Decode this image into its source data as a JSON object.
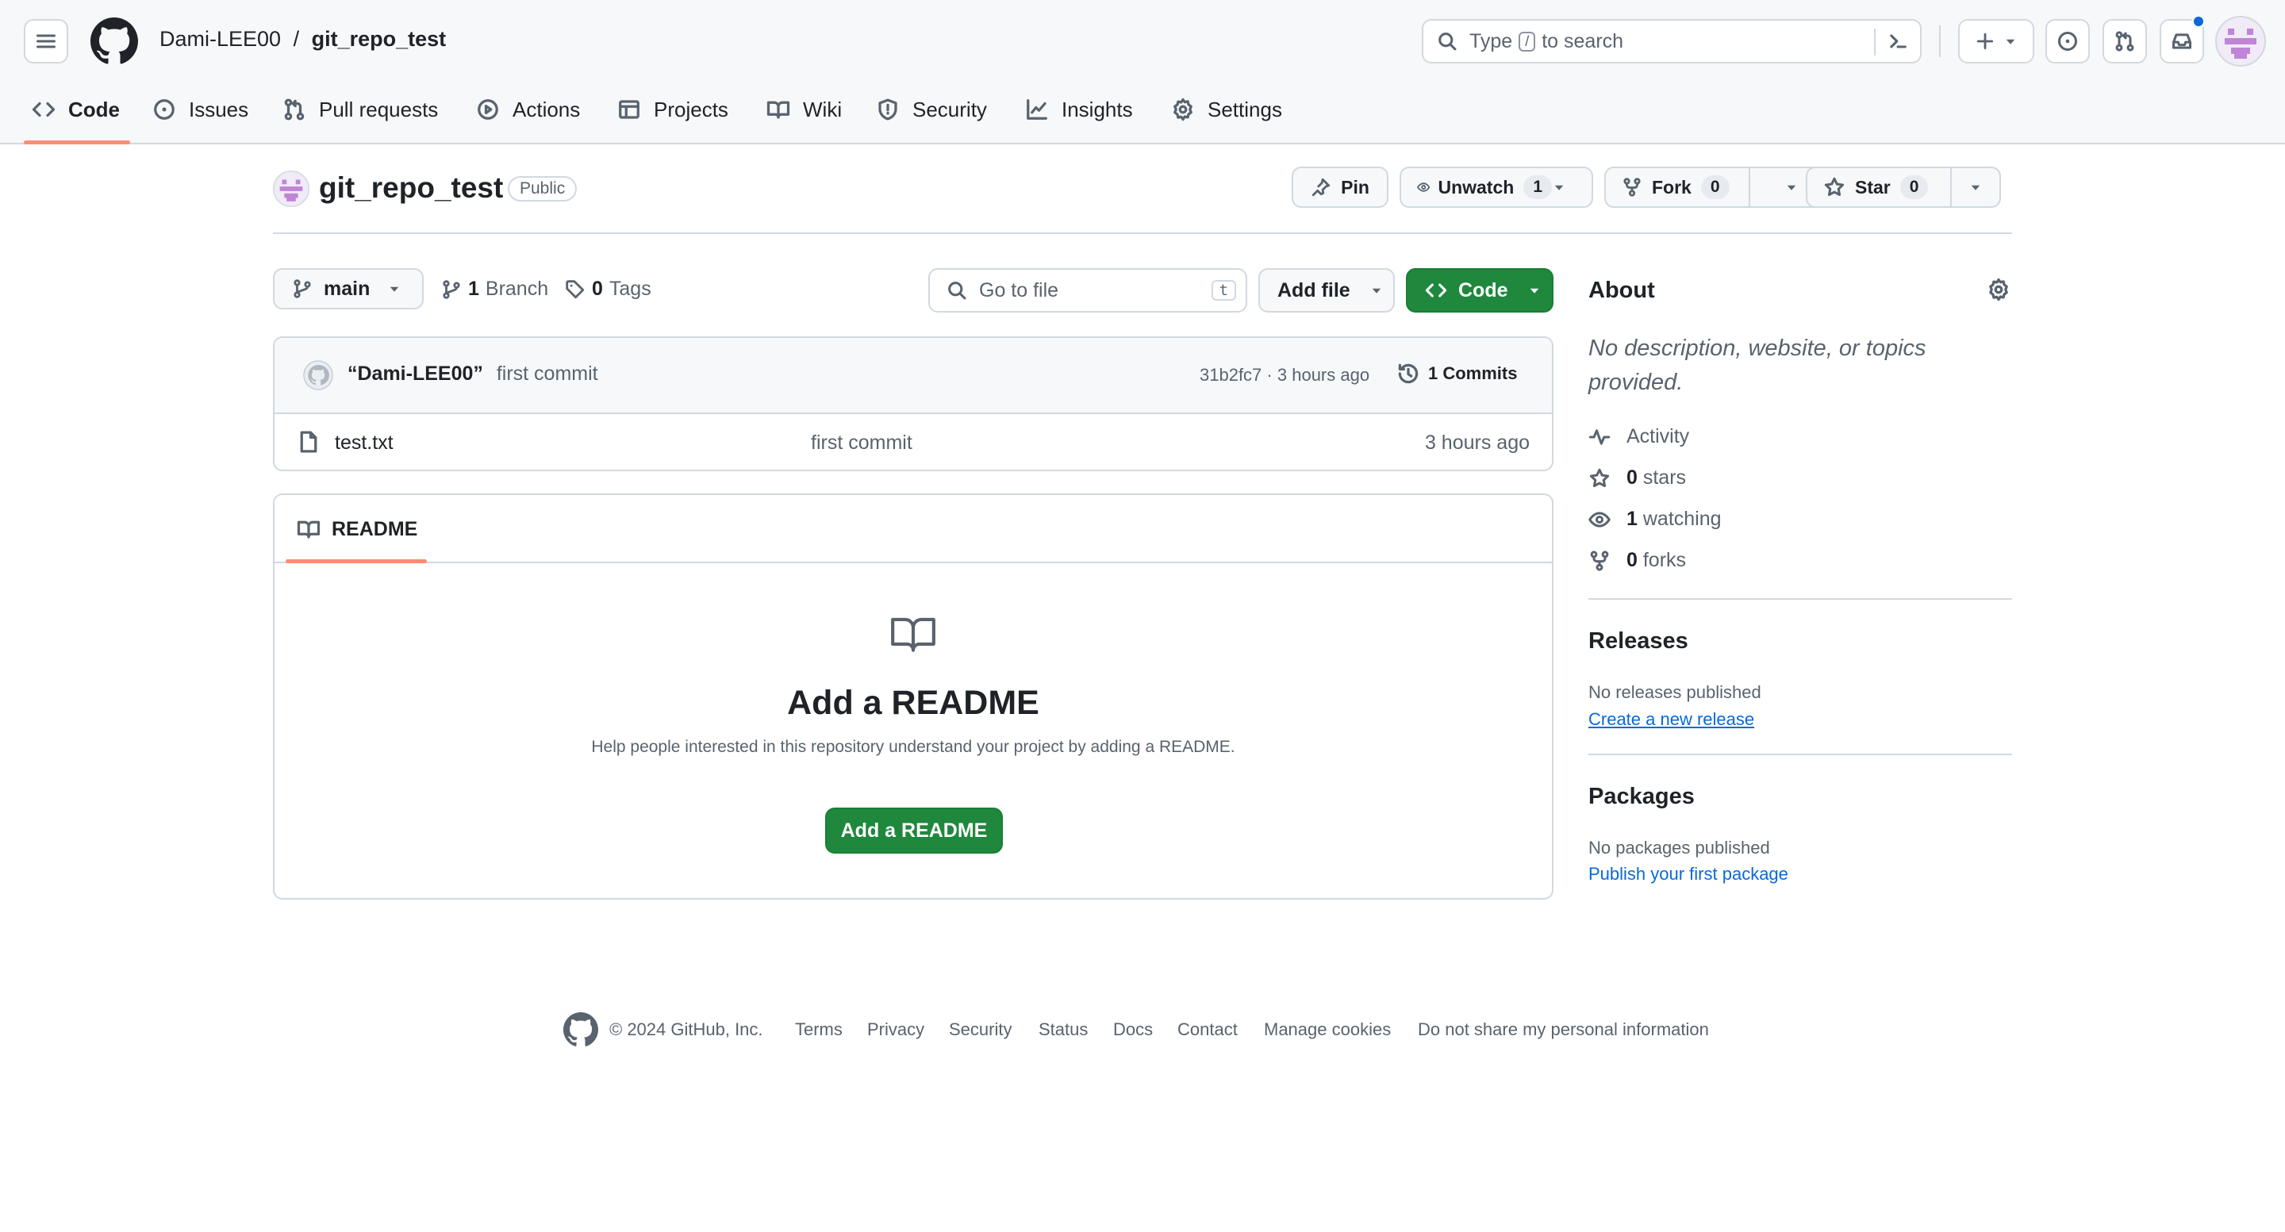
{
  "header": {
    "owner": "Dami-LEE00",
    "separator": "/",
    "repo": "git_repo_test",
    "search_placeholder_pre": "Type",
    "search_key": "/",
    "search_placeholder_post": "to search"
  },
  "nav": {
    "tabs": [
      {
        "label": "Code",
        "icon": "code-icon"
      },
      {
        "label": "Issues",
        "icon": "issue-icon"
      },
      {
        "label": "Pull requests",
        "icon": "pull-request-icon"
      },
      {
        "label": "Actions",
        "icon": "play-icon"
      },
      {
        "label": "Projects",
        "icon": "table-icon"
      },
      {
        "label": "Wiki",
        "icon": "book-icon"
      },
      {
        "label": "Security",
        "icon": "shield-icon"
      },
      {
        "label": "Insights",
        "icon": "graph-icon"
      },
      {
        "label": "Settings",
        "icon": "gear-icon"
      }
    ],
    "selected": "Code",
    "accent": "#fd8c73"
  },
  "repo": {
    "name": "git_repo_test",
    "visibility": "Public",
    "pin_label": "Pin",
    "unwatch_label": "Unwatch",
    "watch_count": "1",
    "fork_label": "Fork",
    "fork_count": "0",
    "star_label": "Star",
    "star_count": "0"
  },
  "toolbar": {
    "branch": "main",
    "branch_count": "1",
    "branch_label": "Branch",
    "tag_count": "0",
    "tag_label": "Tags",
    "goto_placeholder": "Go to file",
    "goto_key": "t",
    "add_file_label": "Add file",
    "code_label": "Code",
    "code_color": "#1f883d"
  },
  "commit": {
    "author": "“Dami-LEE00”",
    "message": "first commit",
    "hash": "31b2fc7",
    "dot": "·",
    "time": "3 hours ago",
    "commits_label": "1 Commits"
  },
  "files": [
    {
      "name": "test.txt",
      "message": "first commit",
      "time": "3 hours ago"
    }
  ],
  "readme": {
    "tab_label": "README",
    "title": "Add a README",
    "description": "Help people interested in this repository understand your project by adding a README.",
    "button_label": "Add a README"
  },
  "about": {
    "title": "About",
    "description": "No description, website, or topics provided.",
    "activity_label": "Activity",
    "stars_count": "0",
    "stars_label": "stars",
    "watching_count": "1",
    "watching_label": "watching",
    "forks_count": "0",
    "forks_label": "forks"
  },
  "releases": {
    "title": "Releases",
    "empty": "No releases published",
    "link": "Create a new release"
  },
  "packages": {
    "title": "Packages",
    "empty": "No packages published",
    "link": "Publish your first package"
  },
  "footer": {
    "copyright": "© 2024 GitHub, Inc.",
    "links": [
      "Terms",
      "Privacy",
      "Security",
      "Status",
      "Docs",
      "Contact",
      "Manage cookies",
      "Do not share my personal information"
    ]
  }
}
